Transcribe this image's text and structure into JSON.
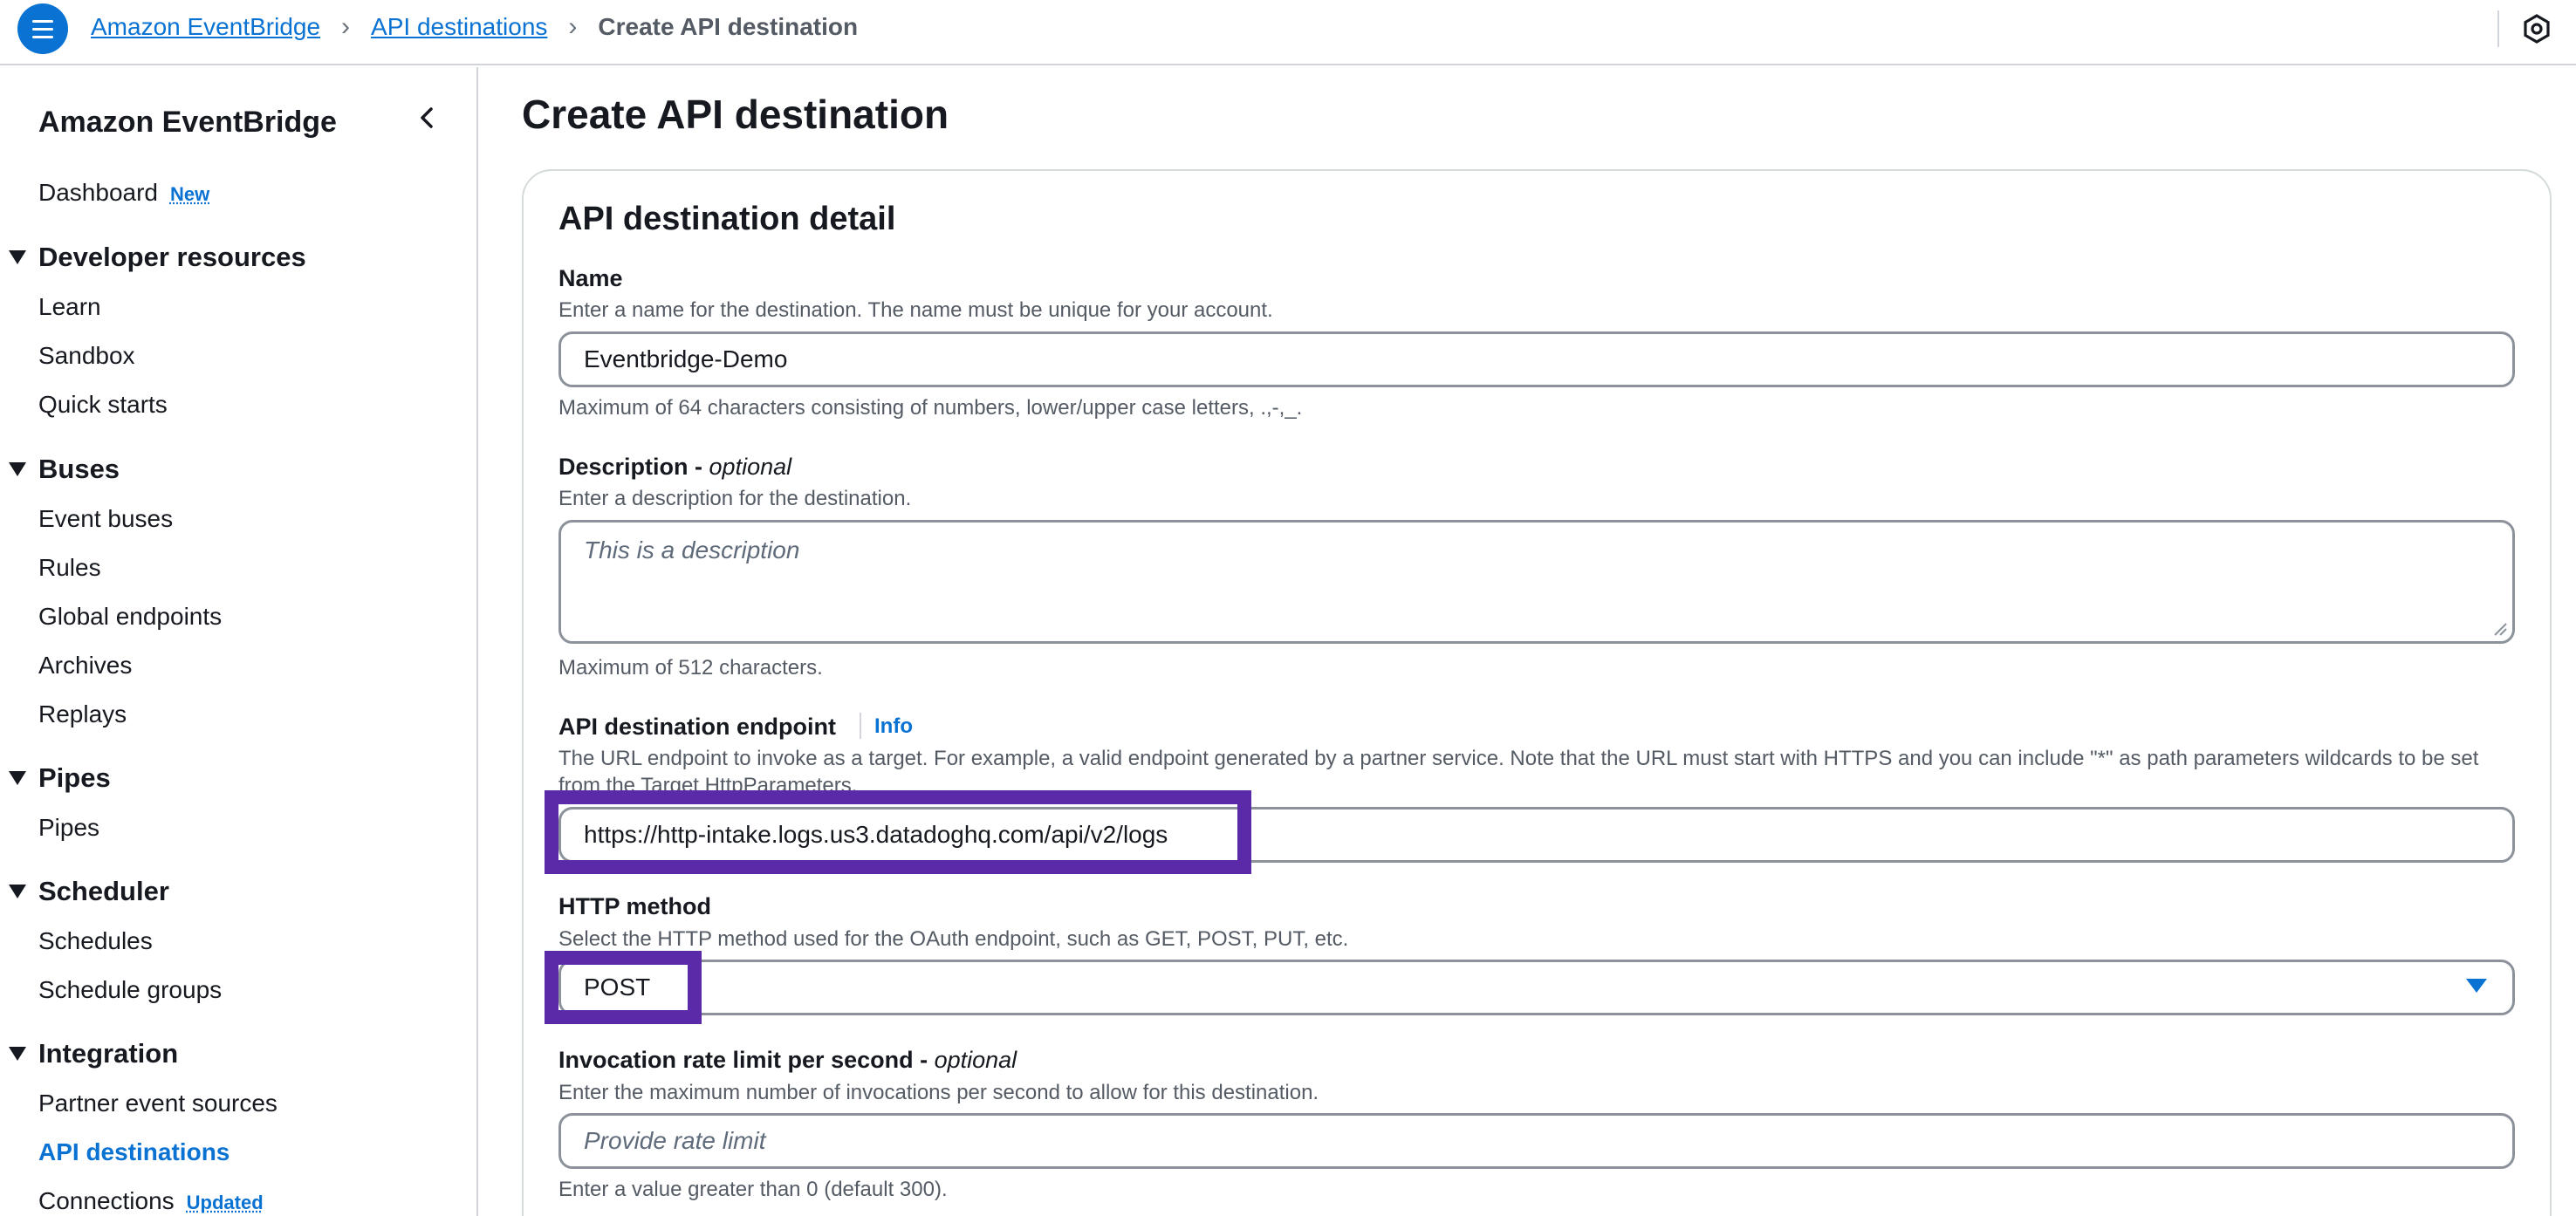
{
  "breadcrumb": {
    "items": [
      "Amazon EventBridge",
      "API destinations"
    ],
    "current": "Create API destination"
  },
  "sidebar": {
    "title": "Amazon EventBridge",
    "dashboard": "Dashboard",
    "dashboard_badge": "New",
    "developer_resources": {
      "title": "Developer resources",
      "items": [
        "Learn",
        "Sandbox",
        "Quick starts"
      ]
    },
    "buses": {
      "title": "Buses",
      "items": [
        "Event buses",
        "Rules",
        "Global endpoints",
        "Archives",
        "Replays"
      ]
    },
    "pipes": {
      "title": "Pipes",
      "items": [
        "Pipes"
      ]
    },
    "scheduler": {
      "title": "Scheduler",
      "items": [
        "Schedules",
        "Schedule groups"
      ]
    },
    "integration": {
      "title": "Integration",
      "items": [
        "Partner event sources",
        "API destinations",
        "Connections"
      ],
      "connections_badge": "Updated"
    }
  },
  "page": {
    "title": "Create API destination",
    "panel_title": "API destination detail"
  },
  "form": {
    "name": {
      "label": "Name",
      "description": "Enter a name for the destination. The name must be unique for your account.",
      "value": "Eventbridge-Demo",
      "hint": "Maximum of 64 characters consisting of numbers, lower/upper case letters, .,-,_."
    },
    "description": {
      "label": "Description - ",
      "label_optional": "optional",
      "description": "Enter a description for the destination.",
      "placeholder": "This is a description",
      "hint": "Maximum of 512 characters."
    },
    "endpoint": {
      "label": "API destination endpoint",
      "info": "Info",
      "description": "The URL endpoint to invoke as a target. For example, a valid endpoint generated by a partner service. Note that the URL must start with HTTPS and you can include \"*\" as path parameters wildcards to be set from the Target HttpParameters.",
      "value": "https://http-intake.logs.us3.datadoghq.com/api/v2/logs"
    },
    "http_method": {
      "label": "HTTP method",
      "description": "Select the HTTP method used for the OAuth endpoint, such as GET, POST, PUT, etc.",
      "value": "POST"
    },
    "rate_limit": {
      "label": "Invocation rate limit per second - ",
      "label_optional": "optional",
      "description": "Enter the maximum number of invocations per second to allow for this destination.",
      "placeholder": "Provide rate limit",
      "hint": "Enter a value greater than 0 (default 300)."
    }
  },
  "colors": {
    "accent": "#0972d3",
    "highlight": "#5b2aa8"
  },
  "icons": {
    "menu": "menu-icon",
    "chevron": "chevron-right-icon",
    "collapse": "chevron-left-icon",
    "notifications": "hexagon-settings-icon",
    "caret": "caret-down-icon"
  }
}
